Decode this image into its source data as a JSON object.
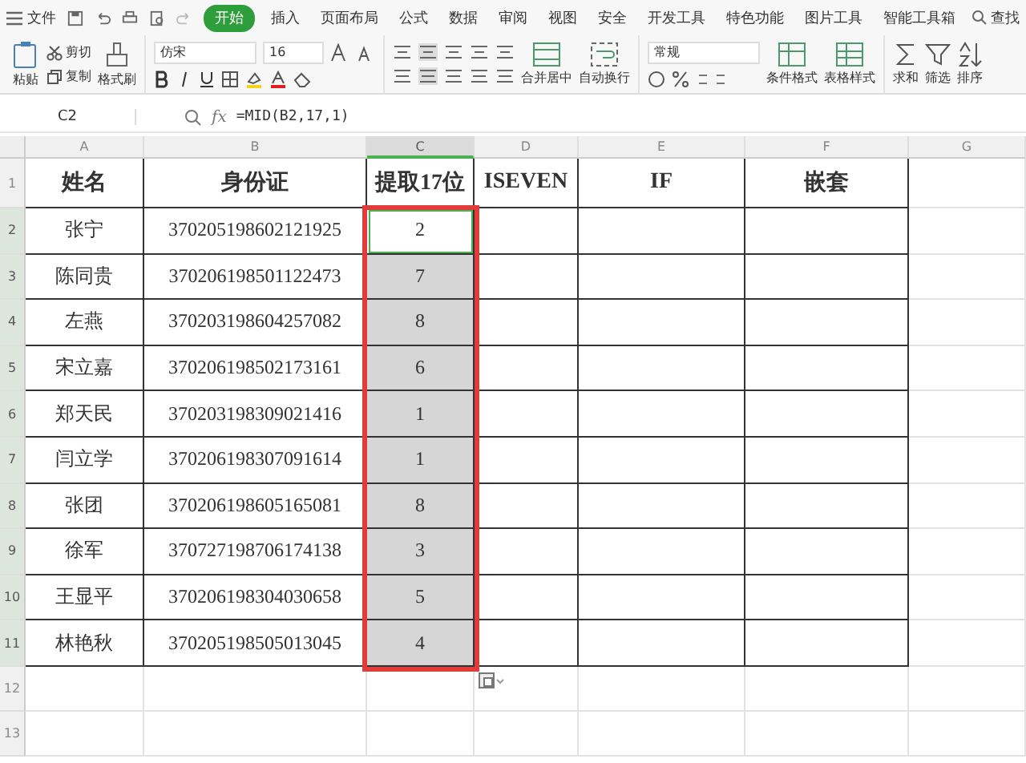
{
  "menu": {
    "file": "文件"
  },
  "tabs": [
    {
      "label": "开始",
      "selected": true
    },
    {
      "label": "插入",
      "selected": false
    },
    {
      "label": "页面布局",
      "selected": false
    },
    {
      "label": "公式",
      "selected": false
    },
    {
      "label": "数据",
      "selected": false
    },
    {
      "label": "审阅",
      "selected": false
    },
    {
      "label": "视图",
      "selected": false
    },
    {
      "label": "安全",
      "selected": false
    },
    {
      "label": "开发工具",
      "selected": false
    },
    {
      "label": "特色功能",
      "selected": false
    },
    {
      "label": "图片工具",
      "selected": false
    },
    {
      "label": "智能工具箱",
      "selected": false
    }
  ],
  "search": {
    "label": "查找"
  },
  "toolbar": {
    "paste": "粘贴",
    "cut": "剪切",
    "copy": "复制",
    "format_painter": "格式刷",
    "font": "仿宋",
    "font_size": "16",
    "merge": "合并居中",
    "wrap": "自动换行",
    "number_format": "常规",
    "conditional": "条件格式",
    "table_style": "表格样式",
    "sum": "求和",
    "filter": "筛选",
    "sort": "排序"
  },
  "formula_bar": {
    "cell": "C2",
    "fx": "fx",
    "formula": "=MID(B2,17,1)"
  },
  "columns": [
    {
      "label": "A",
      "selected": false
    },
    {
      "label": "B",
      "selected": false
    },
    {
      "label": "C",
      "selected": true
    },
    {
      "label": "D",
      "selected": false
    },
    {
      "label": "E",
      "selected": false
    },
    {
      "label": "F",
      "selected": false
    },
    {
      "label": "G",
      "selected": false
    }
  ],
  "rows": [
    {
      "number": "1",
      "selected": false,
      "cells": [
        "姓名",
        "身份证",
        "提取17位",
        "ISEVEN",
        "IF",
        "嵌套"
      ]
    },
    {
      "number": "2",
      "selected": true,
      "active": true,
      "cells": [
        "张宁",
        "370205198602121925",
        "2",
        "",
        "",
        ""
      ]
    },
    {
      "number": "3",
      "selected": true,
      "active": false,
      "cells": [
        "陈同贵",
        "370206198501122473",
        "7",
        "",
        "",
        ""
      ]
    },
    {
      "number": "4",
      "selected": true,
      "active": false,
      "cells": [
        "左燕",
        "370203198604257082",
        "8",
        "",
        "",
        ""
      ]
    },
    {
      "number": "5",
      "selected": true,
      "active": false,
      "cells": [
        "宋立嘉",
        "370206198502173161",
        "6",
        "",
        "",
        ""
      ]
    },
    {
      "number": "6",
      "selected": true,
      "active": false,
      "cells": [
        "郑天民",
        "370203198309021416",
        "1",
        "",
        "",
        ""
      ]
    },
    {
      "number": "7",
      "selected": true,
      "active": false,
      "cells": [
        "闫立学",
        "370206198307091614",
        "1",
        "",
        "",
        ""
      ]
    },
    {
      "number": "8",
      "selected": true,
      "active": false,
      "cells": [
        "张团",
        "370206198605165081",
        "8",
        "",
        "",
        ""
      ]
    },
    {
      "number": "9",
      "selected": true,
      "active": false,
      "cells": [
        "徐军",
        "370727198706174138",
        "3",
        "",
        "",
        ""
      ]
    },
    {
      "number": "10",
      "selected": true,
      "active": false,
      "cells": [
        "王显平",
        "370206198304030658",
        "5",
        "",
        "",
        ""
      ]
    },
    {
      "number": "11",
      "selected": true,
      "active": false,
      "cells": [
        "林艳秋",
        "370205198505013045",
        "4",
        "",
        "",
        ""
      ]
    },
    {
      "number": "12",
      "selected": false,
      "cells": []
    },
    {
      "number": "13",
      "selected": false,
      "cells": []
    }
  ]
}
